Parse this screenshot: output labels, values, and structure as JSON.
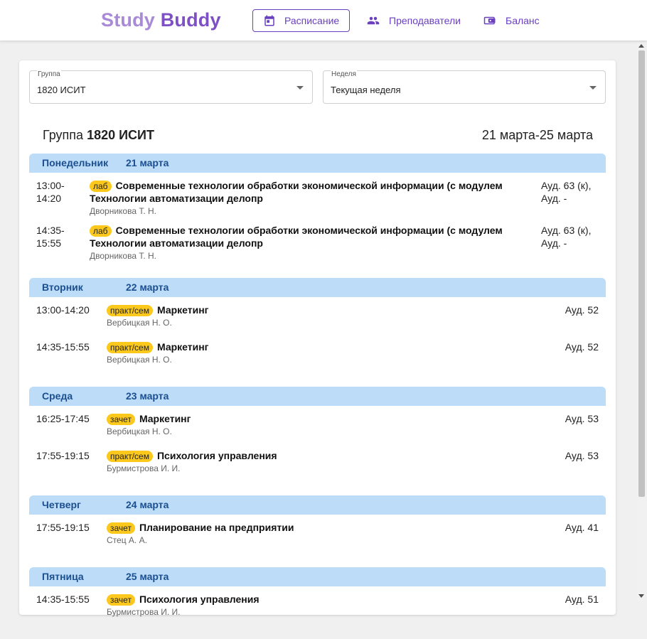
{
  "header": {
    "logo_part1": "Study",
    "logo_part2": "Buddy",
    "nav": [
      {
        "label": "Расписание",
        "icon": "calendar-icon",
        "active": true
      },
      {
        "label": "Преподаватели",
        "icon": "people-icon",
        "active": false
      },
      {
        "label": "Баланс",
        "icon": "wallet-icon",
        "active": false
      }
    ]
  },
  "filters": {
    "group": {
      "label": "Группа",
      "value": "1820 ИСИТ"
    },
    "week": {
      "label": "Неделя",
      "value": "Текущая неделя"
    }
  },
  "schedule": {
    "title_prefix": "Группа",
    "group_name": "1820 ИСИТ",
    "date_range": "21 марта-25 марта"
  },
  "days": [
    {
      "name": "Понедельник",
      "date": "21 марта",
      "lessons": [
        {
          "time_start": "13:00-",
          "time_end": "14:20",
          "type": "лаб",
          "subject": "Современные технологии обработки экономической информации (с модулем Технологии автоматизации делопр",
          "teacher": "Дворникова Т. Н.",
          "room_line1": "Ауд. 63 (к),",
          "room_line2": "Ауд. -"
        },
        {
          "time_start": "14:35-",
          "time_end": "15:55",
          "type": "лаб",
          "subject": "Современные технологии обработки экономической информации (с модулем Технологии автоматизации делопр",
          "teacher": "Дворникова Т. Н.",
          "room_line1": "Ауд. 63 (к),",
          "room_line2": "Ауд. -"
        }
      ]
    },
    {
      "name": "Вторник",
      "date": "22 марта",
      "lessons": [
        {
          "time": "13:00-14:20",
          "type": "практ/сем",
          "subject": "Маркетинг",
          "teacher": "Вербицкая Н. О.",
          "room": "Ауд. 52"
        },
        {
          "time": "14:35-15:55",
          "type": "практ/сем",
          "subject": "Маркетинг",
          "teacher": "Вербицкая Н. О.",
          "room": "Ауд. 52"
        }
      ]
    },
    {
      "name": "Среда",
      "date": "23 марта",
      "lessons": [
        {
          "time": "16:25-17:45",
          "type": "зачет",
          "subject": "Маркетинг",
          "teacher": "Вербицкая Н. О.",
          "room": "Ауд. 53"
        },
        {
          "time": "17:55-19:15",
          "type": "практ/сем",
          "subject": "Психология управления",
          "teacher": "Бурмистрова И. И.",
          "room": "Ауд. 53"
        }
      ]
    },
    {
      "name": "Четверг",
      "date": "24 марта",
      "lessons": [
        {
          "time": "17:55-19:15",
          "type": "зачет",
          "subject": "Планирование на предприятии",
          "teacher": "Стец А. А.",
          "room": "Ауд. 41"
        }
      ]
    },
    {
      "name": "Пятница",
      "date": "25 марта",
      "lessons": [
        {
          "time": "14:35-15:55",
          "type": "зачет",
          "subject": "Психология управления",
          "teacher": "Бурмистрова И. И.",
          "room": "Ауд. 51"
        }
      ]
    }
  ],
  "colors": {
    "brand": "#7d51c4",
    "nav": "#6a3fc0",
    "day_header_bg": "#bcdcf8",
    "day_header_text": "#1c4f8f",
    "badge": "#fcc81c"
  }
}
